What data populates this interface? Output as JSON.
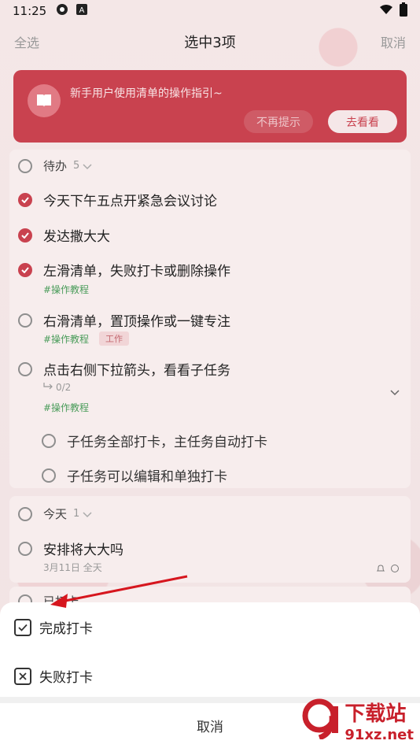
{
  "statusbar": {
    "time": "11:25"
  },
  "topbar": {
    "select_all": "全选",
    "title": "选中3项",
    "cancel": "取消"
  },
  "banner": {
    "text": "新手用户使用清单的操作指引~",
    "dismiss": "不再提示",
    "view": "去看看"
  },
  "group1": {
    "label": "待办",
    "count": "5",
    "tasks": [
      {
        "text": "今天下午五点开紧急会议讨论",
        "checked": true
      },
      {
        "text": "发达撒大大",
        "checked": true
      },
      {
        "text": "左滑清单，失败打卡或删除操作",
        "checked": true,
        "tag": "#操作教程"
      },
      {
        "text": "右滑清单，置顶操作或一键专注",
        "checked": false,
        "tag": "#操作教程",
        "tag2": "工作"
      },
      {
        "text": "点击右侧下拉箭头，看看子任务",
        "checked": false,
        "subtask_count": "0/2",
        "tag": "#操作教程"
      }
    ],
    "subtasks": [
      "子任务全部打卡，主任务自动打卡",
      "子任务可以编辑和单独打卡"
    ]
  },
  "group2": {
    "label": "今天",
    "count": "1",
    "task": {
      "text": "安排将大大吗",
      "meta": "3月11日 全天"
    }
  },
  "group3": {
    "label": "已打卡"
  },
  "sheet": {
    "complete": "完成打卡",
    "fail": "失败打卡",
    "cancel": "取消"
  },
  "watermark": {
    "brand": "下载站",
    "url": "91xz.net"
  },
  "colors": {
    "accent": "#c9424f",
    "tag_green": "#4a9c5a"
  }
}
